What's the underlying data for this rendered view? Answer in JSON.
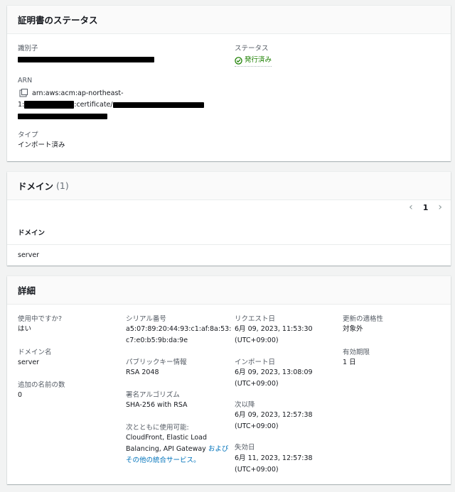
{
  "status_card": {
    "title": "証明書のステータス",
    "identifier_label": "識別子",
    "status_label": "ステータス",
    "status_value": "発行済み",
    "arn_label": "ARN",
    "arn_prefix": "arn:aws:acm:ap-northeast-",
    "arn_line2_prefix": "1:",
    "arn_line2_mid": ":certificate/",
    "type_label": "タイプ",
    "type_value": "インポート済み"
  },
  "domain_card": {
    "title": "ドメイン",
    "count": "(1)",
    "page": "1",
    "column_header": "ドメイン",
    "rows": [
      "server"
    ]
  },
  "details_card": {
    "title": "詳細",
    "in_use_label": "使用中ですか?",
    "in_use_value": "はい",
    "domain_name_label": "ドメイン名",
    "domain_name_value": "server",
    "additional_names_label": "追加の名前の数",
    "additional_names_value": "0",
    "serial_label": "シリアル番号",
    "serial_line1": "a5:07:89:20:44:93:c1:af:8a:53:",
    "serial_line2": "c7:e0:b5:9b:da:9e",
    "pubkey_label": "パブリックキー情報",
    "pubkey_value": "RSA 2048",
    "sigalg_label": "署名アルゴリズム",
    "sigalg_value": "SHA-256 with RSA",
    "usable_label": "次とともに使用可能:",
    "usable_value": "CloudFront, Elastic Load Balancing, API Gateway ",
    "usable_link": "およびその他の統合サービス。",
    "requested_label": "リクエスト日",
    "requested_date": "6月 09, 2023, 11:53:30",
    "requested_tz": "(UTC+09:00)",
    "imported_label": "インポート日",
    "imported_date": "6月 09, 2023, 13:08:09",
    "imported_tz": "(UTC+09:00)",
    "not_before_label": "次以降",
    "not_before_date": "6月 09, 2023, 12:57:38",
    "not_before_tz": "(UTC+09:00)",
    "not_after_label": "失効日",
    "not_after_date": "6月 11, 2023, 12:57:38",
    "not_after_tz": "(UTC+09:00)",
    "renewal_label": "更新の適格性",
    "renewal_value": "対象外",
    "validity_label": "有効期限",
    "validity_value": "1 日"
  },
  "colors": {
    "success": "#1d8102",
    "link": "#0073bb"
  }
}
